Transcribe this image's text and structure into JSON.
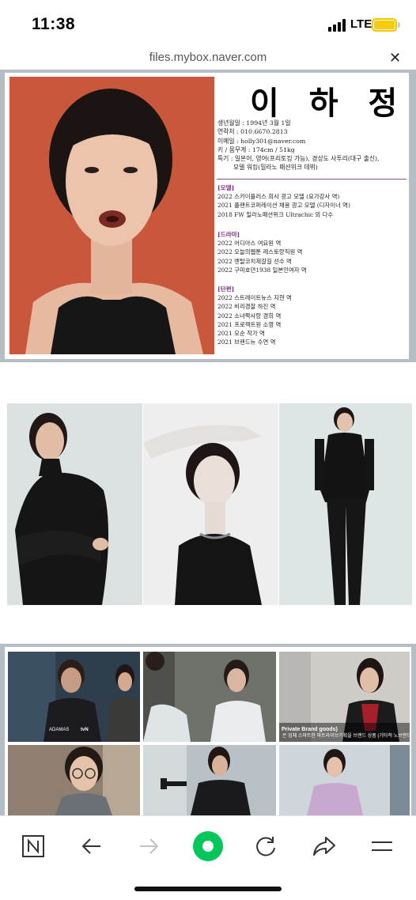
{
  "status_bar": {
    "time": "11:38",
    "network": "LTE"
  },
  "url_bar": {
    "domain": "files.mybox.naver.com",
    "close_icon": "close-icon"
  },
  "profile": {
    "name": "이 하 정",
    "details": [
      "생년월일 : 1994년 3월 1일",
      "연락처 : 010.6670.2813",
      "이메일 : holly301@naver.com",
      "키 / 몸무게 : 174cm / 51kg",
      "특기 : 일본어, 영어(프리토킹 가능), 경상도 사투리(대구 출신),"
    ],
    "details_cont": "모델 워킹(밀라노 패션위크 데뷔)",
    "sections": [
      {
        "title": "[모델]",
        "items": [
          "2022 스카이플러스 회사 광고 모델 (요가강사 역)",
          "2021 플랜트코퍼레이션 채용 광고 모델 (디자이너 역)",
          "2018 FW 밀라노패션위크 Ultrachic 외 다수"
        ]
      },
      {
        "title": "[드라마]",
        "items": [
          "2022 어디아스 여요원 역",
          "2022 오늘의웹툰 레스토랑직원 역",
          "2022 멘탈코치제갈길 선수 역",
          "2022 구미호뎐1938 일본인여자 역"
        ]
      },
      {
        "title": "[단편]",
        "items": [
          "2022 스트레이트뉴스 지현 역",
          "2022 비리경찰 하진 역",
          "2022 소녀짝사랑 경희 역",
          "2021 프로젝트원 소영 역",
          "2021 모순 작가 역",
          "2021 브랜드뉴 수연 역"
        ]
      }
    ]
  },
  "stills": {
    "still1_logo": "ADAMAS",
    "still1_channel": "tvN",
    "still3_caption_head": "Private Brand goods)",
    "still3_caption": "은 업체 스마트한 파트라이브기획을 브랜드 상품 (기타적 노브랜드 등)"
  },
  "toolbar": {
    "items": [
      "naver-n-icon",
      "back-arrow-icon",
      "forward-arrow-icon",
      "green-home-icon",
      "refresh-icon",
      "share-icon",
      "menu-icon"
    ]
  },
  "colors": {
    "accent_green": "#03c75a",
    "section_purple": "#7b2f86",
    "battery_yellow": "#f8cc0a",
    "viewer_gray": "#b7bdc4"
  }
}
